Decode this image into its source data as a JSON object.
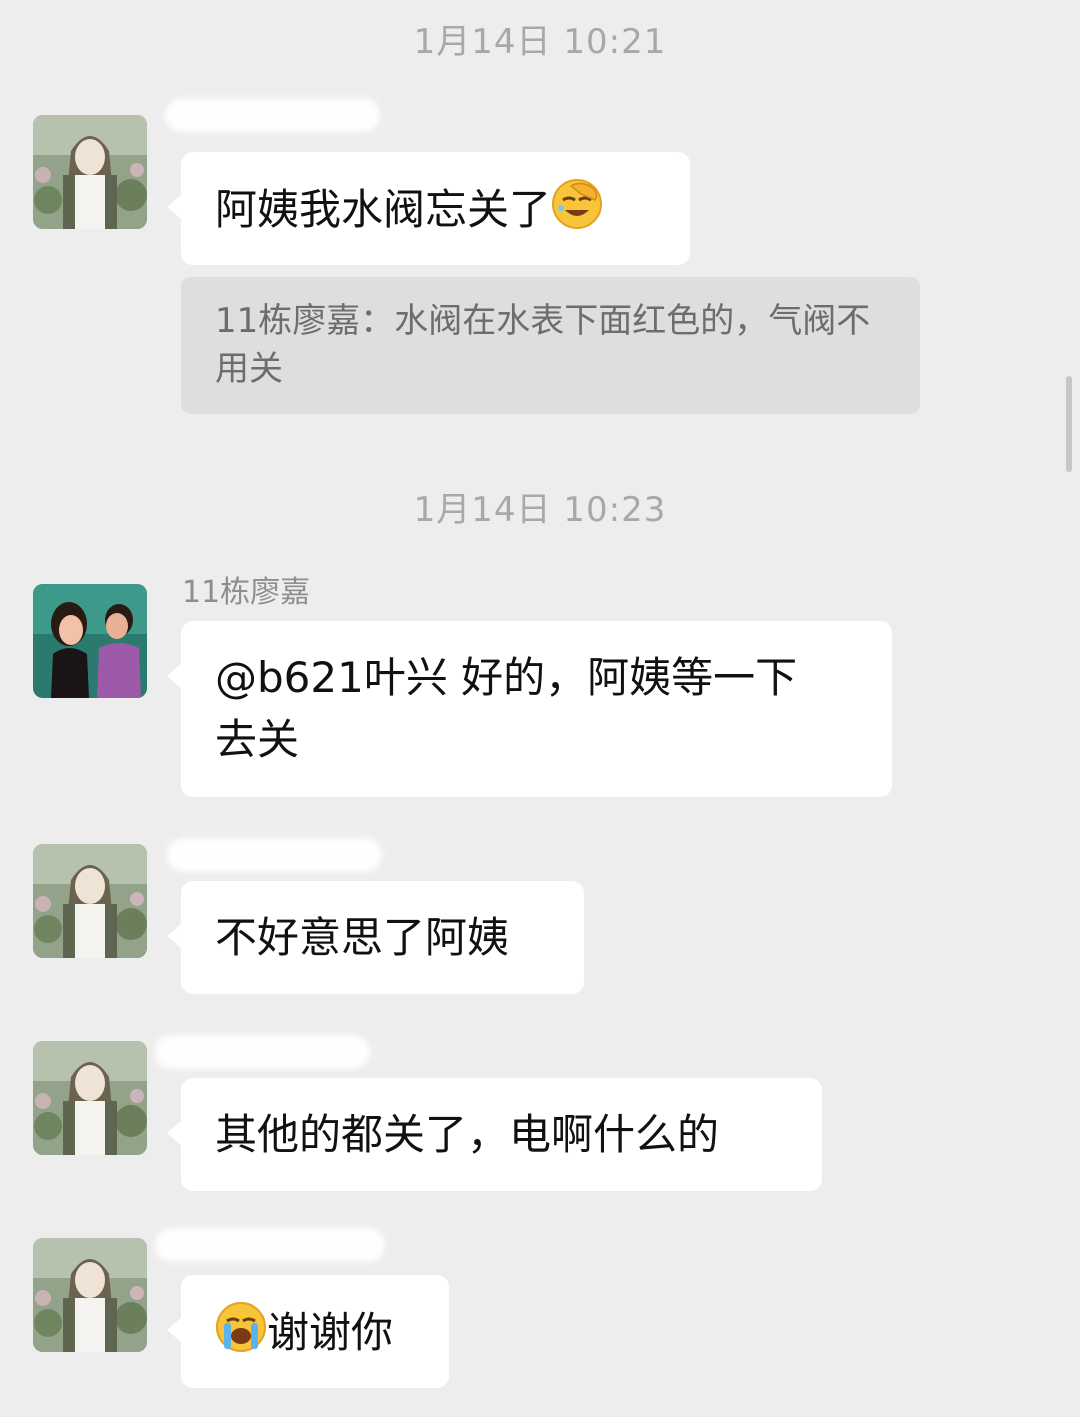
{
  "timestamps": {
    "first": "1月14日 10:21",
    "second": "1月14日 10:23"
  },
  "messages": {
    "m1": {
      "text": "阿姨我水阀忘关了",
      "emoji": "facepalm-laugh-emoji"
    },
    "quote": {
      "text": "11栋廖嘉：水阀在水表下面红色的，气阀不用关"
    },
    "m2": {
      "sender": "11栋廖嘉",
      "line1": "@b621叶兴 好的，阿姨等一下",
      "line2": "去关"
    },
    "m3": {
      "text": "不好意思了阿姨"
    },
    "m4": {
      "text": "其他的都关了，电啊什么的"
    },
    "m5": {
      "text": "谢谢你",
      "emoji": "crying-emoji"
    }
  },
  "colors": {
    "background": "#ededed",
    "bubble": "#ffffff",
    "quote_background": "#dedede",
    "timestamp_text": "#a8a8a8"
  }
}
